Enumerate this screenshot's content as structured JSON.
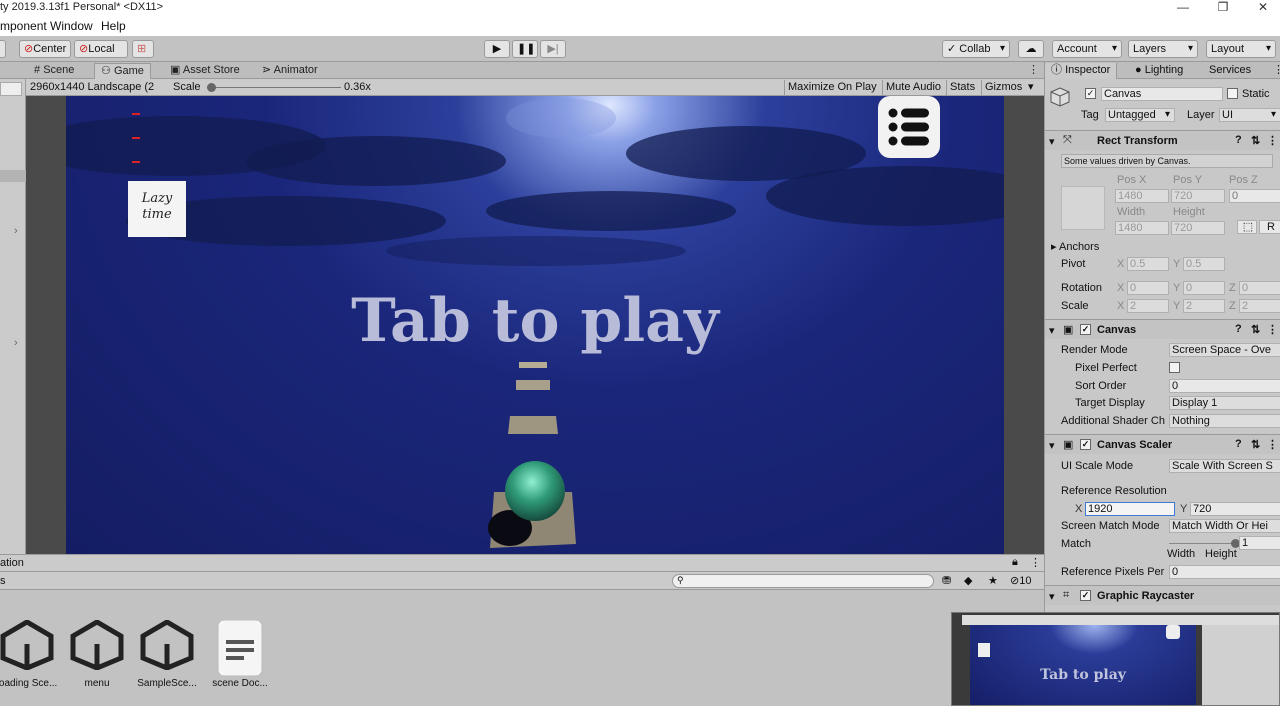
{
  "window": {
    "title": "ty 2019.3.13f1 Personal* <DX11>",
    "controls": {
      "minimize": "—",
      "maximize": "❐",
      "close": "✕"
    }
  },
  "menubar": {
    "items": [
      "mponent",
      "Window",
      "Help"
    ]
  },
  "toolbar": {
    "center": "Center",
    "local": "Local",
    "collab": "Collab",
    "account": "Account",
    "layers": "Layers",
    "layout": "Layout"
  },
  "game_tabs": {
    "scene": "Scene",
    "game": "Game",
    "asset_store": "Asset Store",
    "animator": "Animator"
  },
  "game_bar": {
    "resolution": "2960x1440 Landscape (2",
    "scale_label": "Scale",
    "scale_value": "0.36x",
    "maximize": "Maximize On Play",
    "mute": "Mute Audio",
    "stats": "Stats",
    "gizmos": "Gizmos"
  },
  "game": {
    "play_text": "Tab to play",
    "lazy_line1": "Lazy",
    "lazy_line2": "time"
  },
  "bottom": {
    "tab": "ation",
    "left_label": "s",
    "count": "10",
    "assets": [
      "loading Sce...",
      "menu",
      "SampleSce...",
      "scene Doc..."
    ]
  },
  "inspector": {
    "tabs": {
      "inspector": "Inspector",
      "lighting": "Lighting",
      "services": "Services"
    },
    "object_name": "Canvas",
    "static_label": "Static",
    "tag_label": "Tag",
    "tag_value": "Untagged",
    "layer_label": "Layer",
    "layer_value": "UI",
    "rect_transform": {
      "title": "Rect Transform",
      "note": "Some values driven by Canvas.",
      "posx_label": "Pos X",
      "posy_label": "Pos Y",
      "posz_label": "Pos Z",
      "posx": "1480",
      "posy": "720",
      "posz": "0",
      "width_label": "Width",
      "height_label": "Height",
      "width": "1480",
      "height": "720",
      "anchors": "Anchors",
      "pivot": "Pivot",
      "pivot_x": "0.5",
      "pivot_y": "0.5",
      "rotation": "Rotation",
      "rot_x": "0",
      "rot_y": "0",
      "rot_z": "0",
      "scale": "Scale",
      "scale_x": "2",
      "scale_y": "2",
      "scale_z": "2",
      "x": "X",
      "y": "Y",
      "z": "Z",
      "r": "R"
    },
    "canvas": {
      "title": "Canvas",
      "render_mode_label": "Render Mode",
      "render_mode": "Screen Space - Ove",
      "pixel_perfect": "Pixel Perfect",
      "sort_order_label": "Sort Order",
      "sort_order": "0",
      "target_display_label": "Target Display",
      "target_display": "Display 1",
      "shader_label": "Additional Shader Ch",
      "shader_value": "Nothing"
    },
    "canvas_scaler": {
      "title": "Canvas Scaler",
      "ui_scale_label": "UI Scale Mode",
      "ui_scale": "Scale With Screen S",
      "ref_res_label": "Reference Resolution",
      "ref_x": "1920",
      "ref_y": "720",
      "match_mode_label": "Screen Match Mode",
      "match_mode": "Match Width Or Hei",
      "match_label": "Match",
      "match_value": "1",
      "match_fraction": 1.0,
      "width_word": "Width",
      "height_word": "Height",
      "ref_ppu_label": "Reference Pixels Per",
      "ref_ppu": "0"
    },
    "graphic_raycaster": {
      "title": "Graphic Raycaster"
    }
  },
  "thumbnail": {
    "play_text": "Tab to play"
  }
}
